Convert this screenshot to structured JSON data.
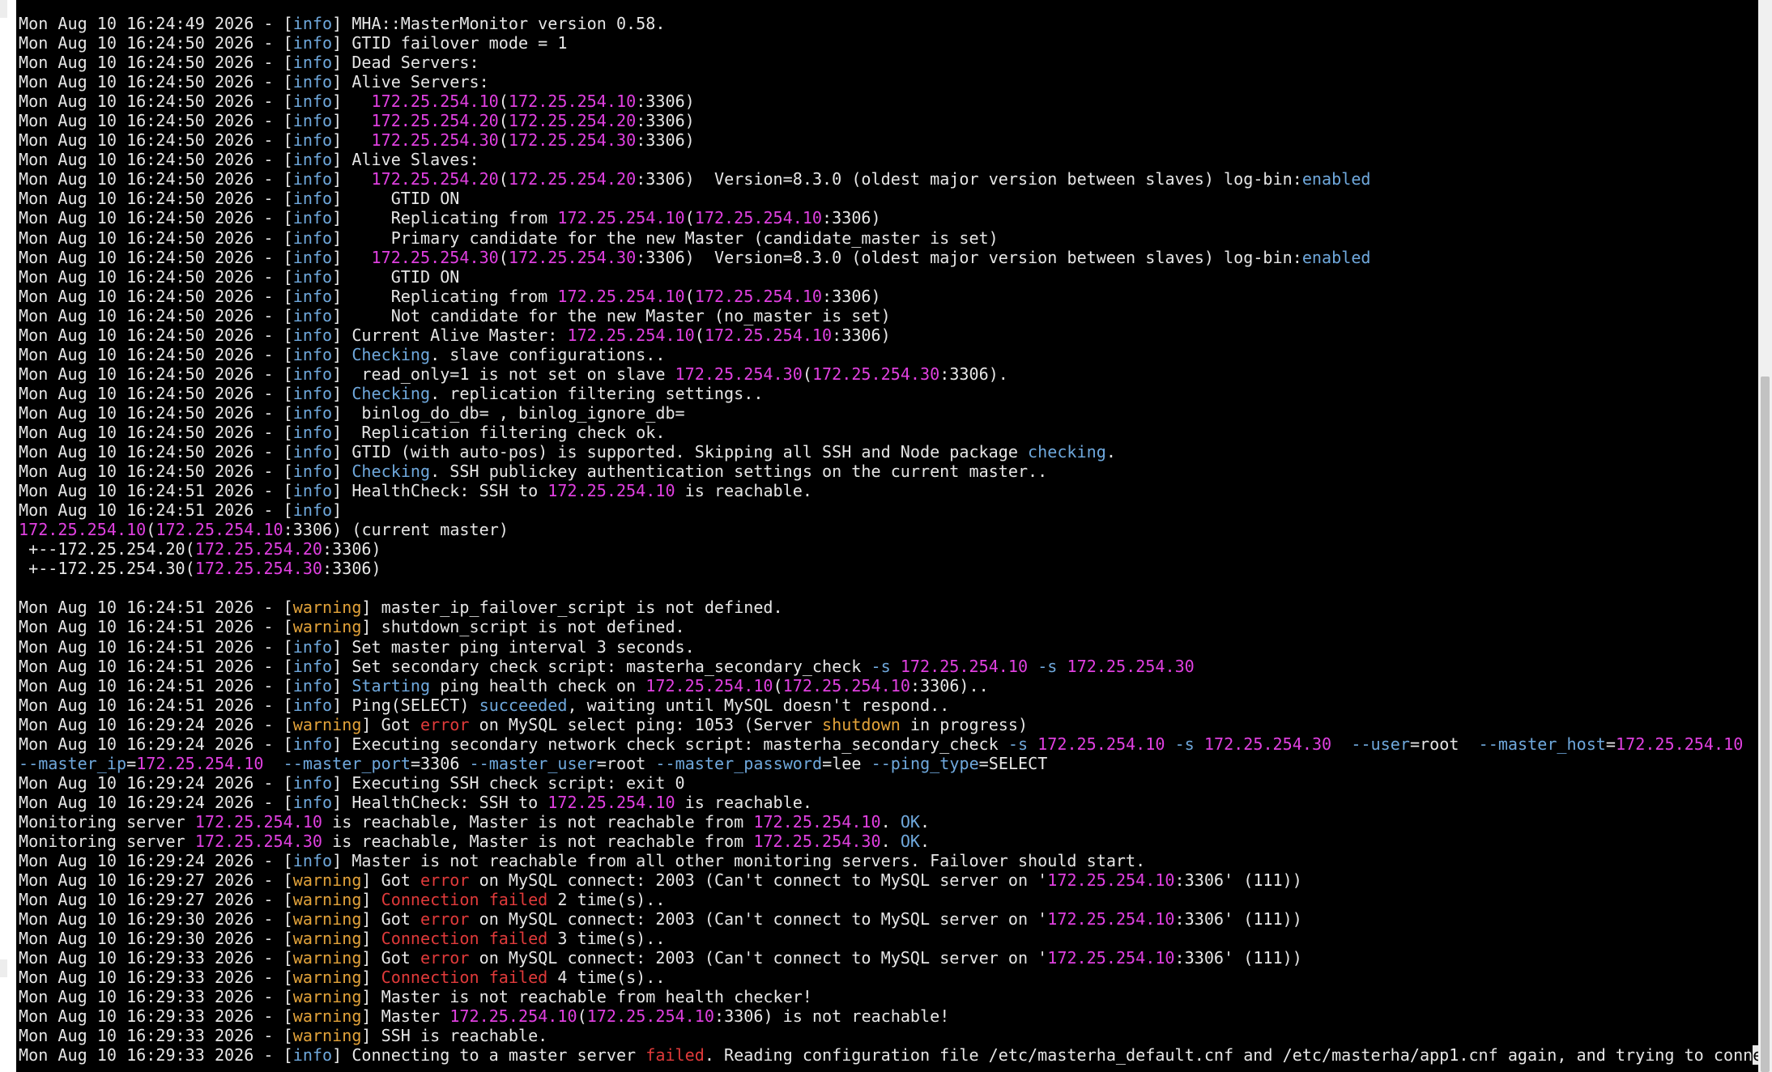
{
  "colors": {
    "background": "#000000",
    "text": "#e6e6e6",
    "info_tag": "#6fa8dc",
    "warning_tag": "#e3a33a",
    "ip_address": "#e040e0",
    "error": "#e03a3a",
    "keyword_blue": "#6fa8dc"
  },
  "terminal": {
    "cursor_char": "e",
    "lines": [
      [
        [
          "",
          "MHA::MasterMonitor version 0.58."
        ]
      ],
      [
        [
          "",
          "Mon Aug 10 16:24:50 2026 - ["
        ],
        [
          "info",
          "info"
        ],
        [
          "",
          "] GTID failover mode = 1"
        ]
      ],
      [
        [
          "",
          "Mon Aug 10 16:24:50 2026 - ["
        ],
        [
          "info",
          "info"
        ],
        [
          "",
          "] Dead Servers:"
        ]
      ],
      [
        [
          "",
          "Mon Aug 10 16:24:50 2026 - ["
        ],
        [
          "info",
          "info"
        ],
        [
          "",
          "] Alive Servers:"
        ]
      ],
      [
        [
          "",
          "Mon Aug 10 16:24:50 2026 - ["
        ],
        [
          "info",
          "info"
        ],
        [
          "",
          "]   "
        ],
        [
          "ip",
          "172.25.254.10"
        ],
        [
          "",
          "("
        ],
        [
          "ip",
          "172.25.254.10"
        ],
        [
          "",
          ":3306)"
        ]
      ],
      [
        [
          "",
          "Mon Aug 10 16:24:50 2026 - ["
        ],
        [
          "info",
          "info"
        ],
        [
          "",
          "]   "
        ],
        [
          "ip",
          "172.25.254.20"
        ],
        [
          "",
          "("
        ],
        [
          "ip",
          "172.25.254.20"
        ],
        [
          "",
          ":3306)"
        ]
      ],
      [
        [
          "",
          "Mon Aug 10 16:24:50 2026 - ["
        ],
        [
          "info",
          "info"
        ],
        [
          "",
          "]   "
        ],
        [
          "ip",
          "172.25.254.30"
        ],
        [
          "",
          "("
        ],
        [
          "ip",
          "172.25.254.30"
        ],
        [
          "",
          ":3306)"
        ]
      ],
      [
        [
          "",
          "Mon Aug 10 16:24:50 2026 - ["
        ],
        [
          "info",
          "info"
        ],
        [
          "",
          "] Alive Slaves:"
        ]
      ],
      [
        [
          "",
          "Mon Aug 10 16:24:50 2026 - ["
        ],
        [
          "info",
          "info"
        ],
        [
          "",
          "]   "
        ],
        [
          "ip",
          "172.25.254.20"
        ],
        [
          "",
          "("
        ],
        [
          "ip",
          "172.25.254.20"
        ],
        [
          "",
          ":3306)  Version=8.3.0 (oldest major version between slaves) log-bin:"
        ],
        [
          "blue",
          "enabled"
        ]
      ],
      [
        [
          "",
          "Mon Aug 10 16:24:50 2026 - ["
        ],
        [
          "info",
          "info"
        ],
        [
          "",
          "]     GTID ON"
        ]
      ],
      [
        [
          "",
          "Mon Aug 10 16:24:50 2026 - ["
        ],
        [
          "info",
          "info"
        ],
        [
          "",
          "]     Replicating from "
        ],
        [
          "ip",
          "172.25.254.10"
        ],
        [
          "",
          "("
        ],
        [
          "ip",
          "172.25.254.10"
        ],
        [
          "",
          ":3306)"
        ]
      ],
      [
        [
          "",
          "Mon Aug 10 16:24:50 2026 - ["
        ],
        [
          "info",
          "info"
        ],
        [
          "",
          "]     Primary candidate for the new Master (candidate_master is set)"
        ]
      ],
      [
        [
          "",
          "Mon Aug 10 16:24:50 2026 - ["
        ],
        [
          "info",
          "info"
        ],
        [
          "",
          "]   "
        ],
        [
          "ip",
          "172.25.254.30"
        ],
        [
          "",
          "("
        ],
        [
          "ip",
          "172.25.254.30"
        ],
        [
          "",
          ":3306)  Version=8.3.0 (oldest major version between slaves) log-bin:"
        ],
        [
          "blue",
          "enabled"
        ]
      ],
      [
        [
          "",
          "Mon Aug 10 16:24:50 2026 - ["
        ],
        [
          "info",
          "info"
        ],
        [
          "",
          "]     GTID ON"
        ]
      ],
      [
        [
          "",
          "Mon Aug 10 16:24:50 2026 - ["
        ],
        [
          "info",
          "info"
        ],
        [
          "",
          "]     Replicating from "
        ],
        [
          "ip",
          "172.25.254.10"
        ],
        [
          "",
          "("
        ],
        [
          "ip",
          "172.25.254.10"
        ],
        [
          "",
          ":3306)"
        ]
      ],
      [
        [
          "",
          "Mon Aug 10 16:24:50 2026 - ["
        ],
        [
          "info",
          "info"
        ],
        [
          "",
          "]     Not candidate for the new Master (no_master is set)"
        ]
      ],
      [
        [
          "",
          "Mon Aug 10 16:24:50 2026 - ["
        ],
        [
          "info",
          "info"
        ],
        [
          "",
          "] Current Alive Master: "
        ],
        [
          "ip",
          "172.25.254.10"
        ],
        [
          "",
          "("
        ],
        [
          "ip",
          "172.25.254.10"
        ],
        [
          "",
          ":3306)"
        ]
      ],
      [
        [
          "",
          "Mon Aug 10 16:24:50 2026 - ["
        ],
        [
          "info",
          "info"
        ],
        [
          "",
          "] "
        ],
        [
          "blue",
          "Checking"
        ],
        [
          "",
          ". slave configurations.."
        ]
      ],
      [
        [
          "",
          "Mon Aug 10 16:24:50 2026 - ["
        ],
        [
          "info",
          "info"
        ],
        [
          "",
          "]  read_only=1 is not set on slave "
        ],
        [
          "ip",
          "172.25.254.30"
        ],
        [
          "",
          "("
        ],
        [
          "ip",
          "172.25.254.30"
        ],
        [
          "",
          ":3306)."
        ]
      ],
      [
        [
          "",
          "Mon Aug 10 16:24:50 2026 - ["
        ],
        [
          "info",
          "info"
        ],
        [
          "",
          "] "
        ],
        [
          "blue",
          "Checking"
        ],
        [
          "",
          ". replication filtering settings.."
        ]
      ],
      [
        [
          "",
          "Mon Aug 10 16:24:50 2026 - ["
        ],
        [
          "info",
          "info"
        ],
        [
          "",
          "]  binlog_do_db= , binlog_ignore_db="
        ]
      ],
      [
        [
          "",
          "Mon Aug 10 16:24:50 2026 - ["
        ],
        [
          "info",
          "info"
        ],
        [
          "",
          "]  Replication filtering check ok."
        ]
      ],
      [
        [
          "",
          "Mon Aug 10 16:24:50 2026 - ["
        ],
        [
          "info",
          "info"
        ],
        [
          "",
          "] GTID (with auto-pos) is supported. Skipping all SSH and Node package "
        ],
        [
          "blue",
          "checking"
        ],
        [
          "",
          "."
        ]
      ],
      [
        [
          "",
          "Mon Aug 10 16:24:50 2026 - ["
        ],
        [
          "info",
          "info"
        ],
        [
          "",
          "] "
        ],
        [
          "blue",
          "Checking"
        ],
        [
          "",
          ". SSH publickey authentication settings on the current master.."
        ]
      ],
      [
        [
          "",
          "Mon Aug 10 16:24:51 2026 - ["
        ],
        [
          "info",
          "info"
        ],
        [
          "",
          "] HealthCheck: SSH to "
        ],
        [
          "ip",
          "172.25.254.10"
        ],
        [
          "",
          " is reachable."
        ]
      ],
      [
        [
          "",
          "Mon Aug 10 16:24:51 2026 - ["
        ],
        [
          "info",
          "info"
        ],
        [
          "",
          "]"
        ]
      ],
      [
        [
          "ip",
          "172.25.254.10"
        ],
        [
          "",
          "("
        ],
        [
          "ip",
          "172.25.254.10"
        ],
        [
          "",
          ":3306) (current master)"
        ]
      ],
      [
        [
          "",
          " +--172.25.254.20("
        ],
        [
          "ip",
          "172.25.254.20"
        ],
        [
          "",
          ":3306)"
        ]
      ],
      [
        [
          "",
          " +--172.25.254.30("
        ],
        [
          "ip",
          "172.25.254.30"
        ],
        [
          "",
          ":3306)"
        ]
      ],
      [
        [
          "",
          ""
        ]
      ],
      [
        [
          "",
          "Mon Aug 10 16:24:51 2026 - ["
        ],
        [
          "warn",
          "warning"
        ],
        [
          "",
          "] master_ip_failover_script is not defined."
        ]
      ],
      [
        [
          "",
          "Mon Aug 10 16:24:51 2026 - ["
        ],
        [
          "warn",
          "warning"
        ],
        [
          "",
          "] shutdown_script is not defined."
        ]
      ],
      [
        [
          "",
          "Mon Aug 10 16:24:51 2026 - ["
        ],
        [
          "info",
          "info"
        ],
        [
          "",
          "] Set master ping interval 3 seconds."
        ]
      ],
      [
        [
          "",
          "Mon Aug 10 16:24:51 2026 - ["
        ],
        [
          "info",
          "info"
        ],
        [
          "",
          "] Set secondary check script: masterha_secondary_check "
        ],
        [
          "blue",
          "-s"
        ],
        [
          "",
          " "
        ],
        [
          "ip",
          "172.25.254.10"
        ],
        [
          "",
          " "
        ],
        [
          "blue",
          "-s"
        ],
        [
          "",
          " "
        ],
        [
          "ip",
          "172.25.254.30"
        ]
      ],
      [
        [
          "",
          "Mon Aug 10 16:24:51 2026 - ["
        ],
        [
          "info",
          "info"
        ],
        [
          "",
          "] "
        ],
        [
          "blue",
          "Starting"
        ],
        [
          "",
          " ping health check on "
        ],
        [
          "ip",
          "172.25.254.10"
        ],
        [
          "",
          "("
        ],
        [
          "ip",
          "172.25.254.10"
        ],
        [
          "",
          ":3306).."
        ]
      ],
      [
        [
          "",
          "Mon Aug 10 16:24:51 2026 - ["
        ],
        [
          "info",
          "info"
        ],
        [
          "",
          "] Ping(SELECT) "
        ],
        [
          "blue",
          "succeeded"
        ],
        [
          "",
          ", waiting until MySQL doesn't respond.."
        ]
      ],
      [
        [
          "",
          "Mon Aug 10 16:29:24 2026 - ["
        ],
        [
          "warn",
          "warning"
        ],
        [
          "",
          "] Got "
        ],
        [
          "err",
          "error"
        ],
        [
          "",
          " on MySQL select ping: 1053 (Server "
        ],
        [
          "warn",
          "shutdown"
        ],
        [
          "",
          " in progress)"
        ]
      ],
      [
        [
          "",
          "Mon Aug 10 16:29:24 2026 - ["
        ],
        [
          "info",
          "info"
        ],
        [
          "",
          "] Executing secondary network check script: masterha_secondary_check "
        ],
        [
          "blue",
          "-s"
        ],
        [
          "",
          " "
        ],
        [
          "ip",
          "172.25.254.10"
        ],
        [
          "",
          " "
        ],
        [
          "blue",
          "-s"
        ],
        [
          "",
          " "
        ],
        [
          "ip",
          "172.25.254.30"
        ],
        [
          "",
          "  "
        ],
        [
          "blue",
          "--user"
        ],
        [
          "",
          "=root  "
        ],
        [
          "blue",
          "--master_host"
        ],
        [
          "",
          "="
        ],
        [
          "ip",
          "172.25.254.10"
        ]
      ],
      [
        [
          "blue",
          "--master_ip"
        ],
        [
          "",
          "="
        ],
        [
          "ip",
          "172.25.254.10"
        ],
        [
          "",
          "  "
        ],
        [
          "blue",
          "--master_port"
        ],
        [
          "",
          "=3306 "
        ],
        [
          "blue",
          "--master_user"
        ],
        [
          "",
          "=root "
        ],
        [
          "blue",
          "--master_password"
        ],
        [
          "",
          "=lee "
        ],
        [
          "blue",
          "--ping_type"
        ],
        [
          "",
          "=SELECT"
        ]
      ],
      [
        [
          "",
          "Mon Aug 10 16:29:24 2026 - ["
        ],
        [
          "info",
          "info"
        ],
        [
          "",
          "] Executing SSH check script: exit 0"
        ]
      ],
      [
        [
          "",
          "Mon Aug 10 16:29:24 2026 - ["
        ],
        [
          "info",
          "info"
        ],
        [
          "",
          "] HealthCheck: SSH to "
        ],
        [
          "ip",
          "172.25.254.10"
        ],
        [
          "",
          " is reachable."
        ]
      ],
      [
        [
          "",
          "Monitoring server "
        ],
        [
          "ip",
          "172.25.254.10"
        ],
        [
          "",
          " is reachable, Master is not reachable from "
        ],
        [
          "ip",
          "172.25.254.10"
        ],
        [
          "",
          ". "
        ],
        [
          "blue",
          "OK"
        ],
        [
          "",
          "."
        ]
      ],
      [
        [
          "",
          "Monitoring server "
        ],
        [
          "ip",
          "172.25.254.30"
        ],
        [
          "",
          " is reachable, Master is not reachable from "
        ],
        [
          "ip",
          "172.25.254.30"
        ],
        [
          "",
          ". "
        ],
        [
          "blue",
          "OK"
        ],
        [
          "",
          "."
        ]
      ],
      [
        [
          "",
          "Mon Aug 10 16:29:24 2026 - ["
        ],
        [
          "info",
          "info"
        ],
        [
          "",
          "] Master is not reachable from all other monitoring servers. Failover should start."
        ]
      ],
      [
        [
          "",
          "Mon Aug 10 16:29:27 2026 - ["
        ],
        [
          "warn",
          "warning"
        ],
        [
          "",
          "] Got "
        ],
        [
          "err",
          "error"
        ],
        [
          "",
          " on MySQL connect: 2003 (Can't connect to MySQL server on '"
        ],
        [
          "ip",
          "172.25.254.10"
        ],
        [
          "",
          ":3306' (111))"
        ]
      ],
      [
        [
          "",
          "Mon Aug 10 16:29:27 2026 - ["
        ],
        [
          "warn",
          "warning"
        ],
        [
          "",
          "] "
        ],
        [
          "err",
          "Connection failed"
        ],
        [
          "",
          " 2 time(s).."
        ]
      ],
      [
        [
          "",
          "Mon Aug 10 16:29:30 2026 - ["
        ],
        [
          "warn",
          "warning"
        ],
        [
          "",
          "] Got "
        ],
        [
          "err",
          "error"
        ],
        [
          "",
          " on MySQL connect: 2003 (Can't connect to MySQL server on '"
        ],
        [
          "ip",
          "172.25.254.10"
        ],
        [
          "",
          ":3306' (111))"
        ]
      ],
      [
        [
          "",
          "Mon Aug 10 16:29:30 2026 - ["
        ],
        [
          "warn",
          "warning"
        ],
        [
          "",
          "] "
        ],
        [
          "err",
          "Connection failed"
        ],
        [
          "",
          " 3 time(s).."
        ]
      ],
      [
        [
          "",
          "Mon Aug 10 16:29:33 2026 - ["
        ],
        [
          "warn",
          "warning"
        ],
        [
          "",
          "] Got "
        ],
        [
          "err",
          "error"
        ],
        [
          "",
          " on MySQL connect: 2003 (Can't connect to MySQL server on '"
        ],
        [
          "ip",
          "172.25.254.10"
        ],
        [
          "",
          ":3306' (111))"
        ]
      ],
      [
        [
          "",
          "Mon Aug 10 16:29:33 2026 - ["
        ],
        [
          "warn",
          "warning"
        ],
        [
          "",
          "] "
        ],
        [
          "err",
          "Connection failed"
        ],
        [
          "",
          " 4 time(s).."
        ]
      ],
      [
        [
          "",
          "Mon Aug 10 16:29:33 2026 - ["
        ],
        [
          "warn",
          "warning"
        ],
        [
          "",
          "] Master is not reachable from health checker!"
        ]
      ],
      [
        [
          "",
          "Mon Aug 10 16:29:33 2026 - ["
        ],
        [
          "warn",
          "warning"
        ],
        [
          "",
          "] Master "
        ],
        [
          "ip",
          "172.25.254.10"
        ],
        [
          "",
          "("
        ],
        [
          "ip",
          "172.25.254.10"
        ],
        [
          "",
          ":3306) is not reachable!"
        ]
      ],
      [
        [
          "",
          "Mon Aug 10 16:29:33 2026 - ["
        ],
        [
          "warn",
          "warning"
        ],
        [
          "",
          "] SSH is reachable."
        ]
      ],
      [
        [
          "",
          "Mon Aug 10 16:29:33 2026 - ["
        ],
        [
          "info",
          "info"
        ],
        [
          "",
          "] Connecting to a master server "
        ],
        [
          "err",
          "failed"
        ],
        [
          "",
          ". Reading configuration file /etc/masterha_default.cnf and /etc/masterha/app1.cnf again, and trying to conn"
        ]
      ]
    ]
  }
}
